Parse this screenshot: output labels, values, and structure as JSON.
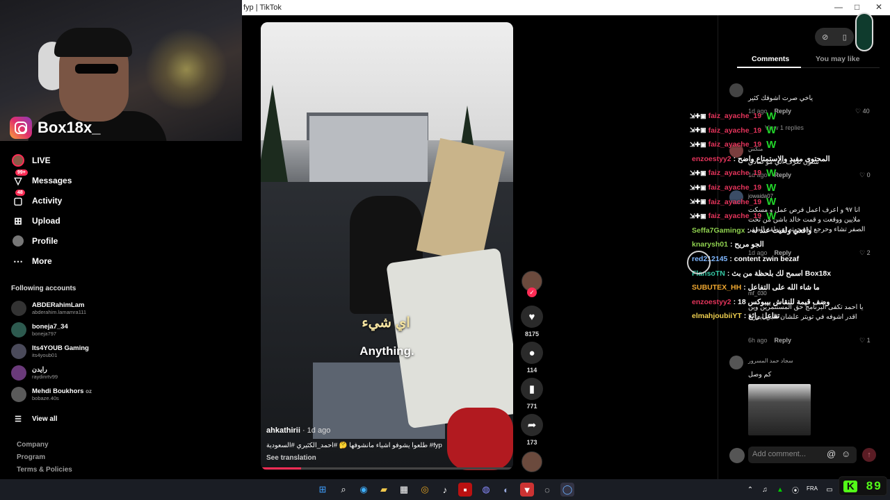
{
  "window": {
    "title": "fyp | TikTok",
    "controls": [
      "—",
      "□",
      "✕"
    ]
  },
  "streamer": {
    "instagram_handle": "Box18x_"
  },
  "sidebar": {
    "nav": [
      {
        "label": "LIVE",
        "icon": "live-avatar-icon"
      },
      {
        "label": "Messages",
        "icon": "messages-icon",
        "badge": "99+"
      },
      {
        "label": "Activity",
        "icon": "activity-icon",
        "badge": "48"
      },
      {
        "label": "Upload",
        "icon": "upload-icon"
      },
      {
        "label": "Profile",
        "icon": "profile-icon"
      },
      {
        "label": "More",
        "icon": "more-icon"
      }
    ],
    "following_title": "Following accounts",
    "accounts": [
      {
        "name": "ABDERahimLam",
        "handle": "abderahim.lamamra111"
      },
      {
        "name": "boneja7_34",
        "handle": "boneja797"
      },
      {
        "name": "Its4YOUB Gaming",
        "handle": "its4youb01"
      },
      {
        "name": "رايدن",
        "handle": "raydinrtv99"
      },
      {
        "name": "Mehdi Boukhors",
        "handle": "bobaze.40s",
        "suffix": "oz"
      }
    ],
    "view_all": "View all",
    "footer": [
      "Company",
      "Program",
      "Terms & Policies"
    ]
  },
  "video": {
    "subtitle_ar": "اي شيء",
    "subtitle_en": "Anything.",
    "author": "ahkathirii",
    "posted": " · 1d ago",
    "caption": "طلعوا يشوفو اشياء مانشوفها 🤔 #احمد_الكثيري #السعودية #fyp",
    "see_translation": "See translation",
    "progress": 0.16
  },
  "actions": {
    "likes": "8175",
    "comments": "114",
    "saves": "771",
    "shares": "173"
  },
  "comments_panel": {
    "tabs": [
      "Comments",
      "You may like"
    ],
    "active_tab": "Comments",
    "comments": [
      {
        "text": "ياخي صرت اشوفك كثير",
        "meta": "1d ago",
        "reply": "Reply",
        "likes": "40",
        "view_replies": "View 1 replies"
      },
      {
        "user": "منكس",
        "text": "شلون تعرف الي مو صادق",
        "meta": "1d ago",
        "reply": "Reply",
        "likes": "0"
      },
      {
        "user": "jowaida07",
        "text": "انا ٩٧ و اعرف اعمل فرص عمل و مسكت ملايين ووقعت و قمت خالد باشن من تحت الصفر تشاء وحرجع له وجهته لمنطقة الصفر",
        "meta": "1d ago",
        "reply": "Reply",
        "likes": "2"
      },
      {
        "user": "mf_030",
        "text": "يا احمد تكفى البرنامج حق المستثمرين وين اقدر اشوفه في تويتر علشان قلبي ايش؟",
        "meta": "6h ago",
        "reply": "Reply",
        "likes": "1"
      },
      {
        "user": "سجاد حمد المسرور",
        "text": "كم وصل",
        "meta": "",
        "reply": "",
        "likes": ""
      }
    ],
    "add_comment_placeholder": "Add comment..."
  },
  "chat": [
    {
      "user": "faiz_ayache_19",
      "msg": "W",
      "color": "#e4345b"
    },
    {
      "user": "faiz_ayache_19",
      "msg": "W",
      "color": "#e4345b"
    },
    {
      "user": "faiz_ayache_19",
      "msg": "W",
      "color": "#e4345b"
    },
    {
      "user": "enzoestyy2",
      "msg": ": المحتوى مفيد والإستمتاع واضح",
      "color": "#e4345b"
    },
    {
      "user": "faiz_ayache_19",
      "msg": "W",
      "color": "#e4345b"
    },
    {
      "user": "faiz_ayache_19",
      "msg": "W",
      "color": "#e4345b"
    },
    {
      "user": "faiz_ayache_19",
      "msg": "W",
      "color": "#e4345b"
    },
    {
      "user": "faiz_ayache_19",
      "msg": "W",
      "color": "#e4345b"
    },
    {
      "user": "Seffa7Gamingx",
      "msg": ": واقعي ولقيت عند له",
      "color": "#8fd14f"
    },
    {
      "user": "knarysh01",
      "msg": ": الجو مريح",
      "color": "#8fd14f"
    },
    {
      "user": "red212145",
      "msg": ": content zwin bezaf",
      "color": "#7fb7ff"
    },
    {
      "user": "FlansoTN",
      "msg": ": اسمح لك بلحظة من بث Box18x",
      "color": "#36c7a4"
    },
    {
      "user": "SUBUTEX_HH",
      "msg": ": ما شاء الله على التفاعل",
      "color": "#f0a830"
    },
    {
      "user": "enzoestyy2",
      "msg": ": وضف قيمة للنقاش بيبوكس 18",
      "color": "#e4345b"
    },
    {
      "user": "elmahjoubiiYT",
      "msg": ": تفاعل رائع",
      "color": "#f0d050"
    }
  ],
  "taskbar": {
    "lang": "FRA",
    "kick_viewers": "89"
  },
  "colors": {
    "accent": "#fe2c55",
    "kick_green": "#53fc18"
  }
}
